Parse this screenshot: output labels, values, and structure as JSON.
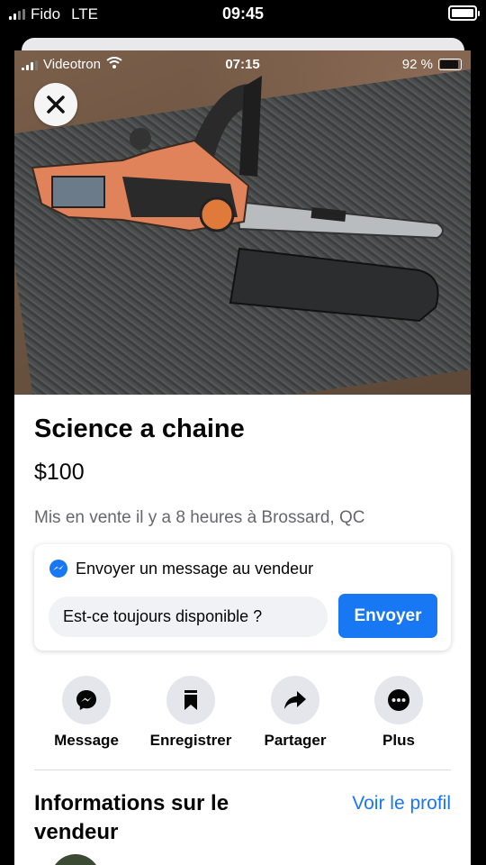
{
  "outer_status": {
    "carrier": "Fido",
    "network": "LTE",
    "time": "09:45"
  },
  "inner_status": {
    "carrier": "Videotron",
    "time": "07:15",
    "battery": "92 %"
  },
  "listing": {
    "title": "Science a chaine",
    "price": "$100",
    "meta": "Mis en vente il y a 8 heures à Brossard, QC"
  },
  "message": {
    "heading": "Envoyer un message au vendeur",
    "input_value": "Est-ce toujours disponible ?",
    "send_label": "Envoyer"
  },
  "actions": [
    {
      "label": "Message",
      "icon": "messenger-icon"
    },
    {
      "label": "Enregistrer",
      "icon": "bookmark-icon"
    },
    {
      "label": "Partager",
      "icon": "share-icon"
    },
    {
      "label": "Plus",
      "icon": "more-icon"
    }
  ],
  "seller": {
    "title": "Informations sur le vendeur",
    "profile_link": "Voir le profil"
  },
  "colors": {
    "accent": "#1877f2",
    "secondary_text": "#65676b",
    "button_bg": "#e4e6eb"
  }
}
